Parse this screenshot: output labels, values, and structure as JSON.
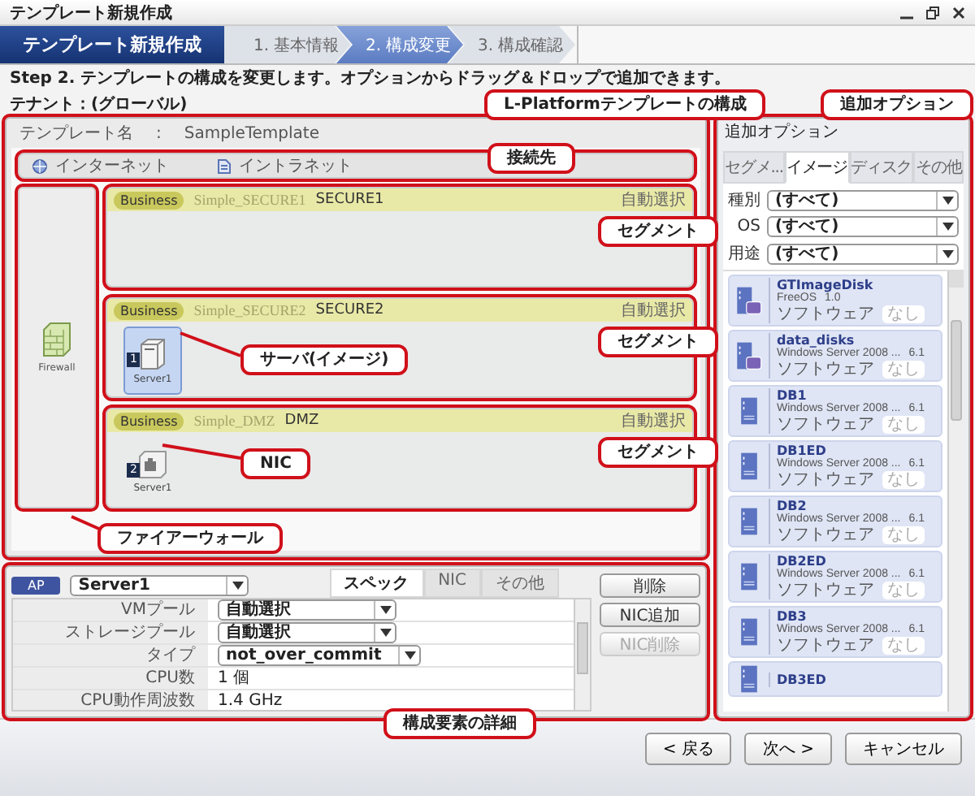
{
  "window": {
    "title": "テンプレート新規作成"
  },
  "wizard": {
    "title": "テンプレート新規作成",
    "steps": [
      {
        "label": "1. 基本情報",
        "selected": false
      },
      {
        "label": "2. 構成変更",
        "selected": true
      },
      {
        "label": "3. 構成確認",
        "selected": false
      }
    ]
  },
  "instruction": "Step 2. テンプレートの構成を変更します。オプションからドラッグ＆ドロップで追加できます。",
  "tenant": "テナント：(グローバル)",
  "template": {
    "name_label": "テンプレート名",
    "separator": ":",
    "name": "SampleTemplate",
    "connections": [
      {
        "kind": "internet",
        "label": "インターネット"
      },
      {
        "kind": "intranet",
        "label": "イントラネット"
      }
    ],
    "firewall": {
      "label": "Firewall"
    },
    "segments": [
      {
        "tag": "Business",
        "id_name": "Simple_SECURE1",
        "name": "SECURE1",
        "mode": "自動選択"
      },
      {
        "tag": "Business",
        "id_name": "Simple_SECURE2",
        "name": "SECURE2",
        "mode": "自動選択",
        "nodes": [
          {
            "kind": "server",
            "badge": "1",
            "label": "Server1",
            "selected": true
          }
        ]
      },
      {
        "tag": "Business",
        "id_name": "Simple_DMZ",
        "name": "DMZ",
        "mode": "自動選択",
        "nodes": [
          {
            "kind": "nic",
            "badge": "2",
            "label": "Server1",
            "selected": false
          }
        ]
      }
    ]
  },
  "options": {
    "title": "追加オプション",
    "tabs": [
      {
        "label": "セグメ...",
        "selected": false
      },
      {
        "label": "イメージ",
        "selected": true
      },
      {
        "label": "ディスク",
        "selected": false
      },
      {
        "label": "その他",
        "selected": false
      }
    ],
    "filters": [
      {
        "label": "種別",
        "value": "(すべて)"
      },
      {
        "label": "OS",
        "value": "(すべて)"
      },
      {
        "label": "用途",
        "value": "(すべて)"
      }
    ],
    "images": [
      {
        "kind": "disk",
        "name": "GTImageDisk",
        "os": "FreeOS",
        "version": "1.0",
        "software_label": "ソフトウェア",
        "software": "なし"
      },
      {
        "kind": "disk",
        "name": "data_disks",
        "os": "Windows Server 2008 ...",
        "version": "6.1",
        "software_label": "ソフトウェア",
        "software": "なし"
      },
      {
        "kind": "server",
        "name": "DB1",
        "os": "Windows Server 2008 ...",
        "version": "6.1",
        "software_label": "ソフトウェア",
        "software": "なし"
      },
      {
        "kind": "server",
        "name": "DB1ED",
        "os": "Windows Server 2008 ...",
        "version": "6.1",
        "software_label": "ソフトウェア",
        "software": "なし"
      },
      {
        "kind": "server",
        "name": "DB2",
        "os": "Windows Server 2008 ...",
        "version": "6.1",
        "software_label": "ソフトウェア",
        "software": "なし"
      },
      {
        "kind": "server",
        "name": "DB2ED",
        "os": "Windows Server 2008 ...",
        "version": "6.1",
        "software_label": "ソフトウェア",
        "software": "なし"
      },
      {
        "kind": "server",
        "name": "DB3",
        "os": "Windows Server 2008 ...",
        "version": "6.1",
        "software_label": "ソフトウェア",
        "software": "なし"
      },
      {
        "kind": "server",
        "name": "DB3ED"
      }
    ]
  },
  "detail": {
    "type_badge": "AP",
    "server": "Server1",
    "tabs": [
      {
        "label": "スペック",
        "selected": true
      },
      {
        "label": "NIC",
        "selected": false
      },
      {
        "label": "その他",
        "selected": false
      }
    ],
    "rows": [
      {
        "label": "VMプール",
        "kind": "select",
        "value": "自動選択"
      },
      {
        "label": "ストレージプール",
        "kind": "select",
        "value": "自動選択"
      },
      {
        "label": "タイプ",
        "kind": "select",
        "value": "not_over_commit"
      },
      {
        "label": "CPU数",
        "kind": "text",
        "value": "1 個"
      },
      {
        "label": "CPU動作周波数",
        "kind": "text",
        "value": "1.4 GHz"
      }
    ],
    "buttons": [
      {
        "label": "削除",
        "disabled": false
      },
      {
        "label": "NIC追加",
        "disabled": false
      },
      {
        "label": "NIC削除",
        "disabled": true
      }
    ]
  },
  "footer": {
    "buttons": [
      "< 戻る",
      "次へ >",
      "キャンセル"
    ]
  },
  "annotations": [
    {
      "label": "L-Platformテンプレートの構成"
    },
    {
      "label": "接続先"
    },
    {
      "label": "セグメント"
    },
    {
      "label": "セグメント"
    },
    {
      "label": "セグメント"
    },
    {
      "label": "サーバ(イメージ)"
    },
    {
      "label": "NIC"
    },
    {
      "label": "ファイアーウォール"
    },
    {
      "label": "追加オプション"
    },
    {
      "label": "構成要素の詳細"
    }
  ]
}
